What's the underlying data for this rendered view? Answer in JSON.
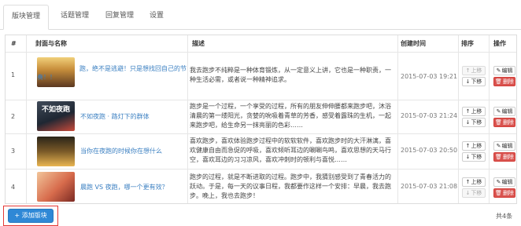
{
  "tabs": [
    {
      "label": "版块管理"
    },
    {
      "label": "话题管理"
    },
    {
      "label": "回复管理"
    },
    {
      "label": "设置"
    }
  ],
  "table": {
    "columns": {
      "num": "#",
      "cover": "封面与名称",
      "desc": "描述",
      "created": "创建时间",
      "order": "排序",
      "ops": "操作"
    },
    "rows": [
      {
        "num": "1",
        "title": "跑，绝不是逃避！只是想找回自己的节奏！！",
        "desc": "我去跑步不纯粹是一种体育锻炼，从一定意义上讲，它也是一种职责，一种生活必需，或者说一种精神追求。",
        "created": "2015-07-03 19:21",
        "thumb_text": ""
      },
      {
        "num": "2",
        "title": "不如夜跑 · 路灯下的群体",
        "desc": "跑步是一个过程，一个享受的过程，所有的朋友伸伸腰都来跑步吧，沐浴清晨的第一缕阳光，贪婪的吮吸着青草的芳香，感受着露珠的生机，一起来跑步吧，给生命另一抹亮丽的色彩……",
        "created": "2015-07-03 21:24",
        "thumb_text": "不如夜跑"
      },
      {
        "num": "3",
        "title": "当你在夜跑的时候你在想什么",
        "desc": "喜欢跑步，喜欢体验跑步过程中的软软软件，喜欢跑步时的大汗淋漓，喜欢健康自由而急促的呼吸，喜欢倾听耳边的唰唰鸟鸣，喜欢思想的天马行空，喜欢耳边的习习凉风，喜欢冲刺时的顿利与喜悦……",
        "created": "2015-07-03 20:50",
        "thumb_text": ""
      },
      {
        "num": "4",
        "title": "晨跑 VS 夜跑，哪一个更有效？",
        "desc": "跑步的过程，就是不断进取的过程。跑步中，我猜别感受到了青春活力的跃动。于是，每一天的议事日程，我都要作这样一个安排：早晨，我去跑步。晚上，我也去跑步！",
        "created": "2015-07-03 21:08",
        "thumb_text": ""
      }
    ],
    "buttons": {
      "up": "上移",
      "down": "下移",
      "edit": "编辑",
      "delete": "删除"
    }
  },
  "footer": {
    "add_label": "添加版块",
    "total": "共4条"
  }
}
